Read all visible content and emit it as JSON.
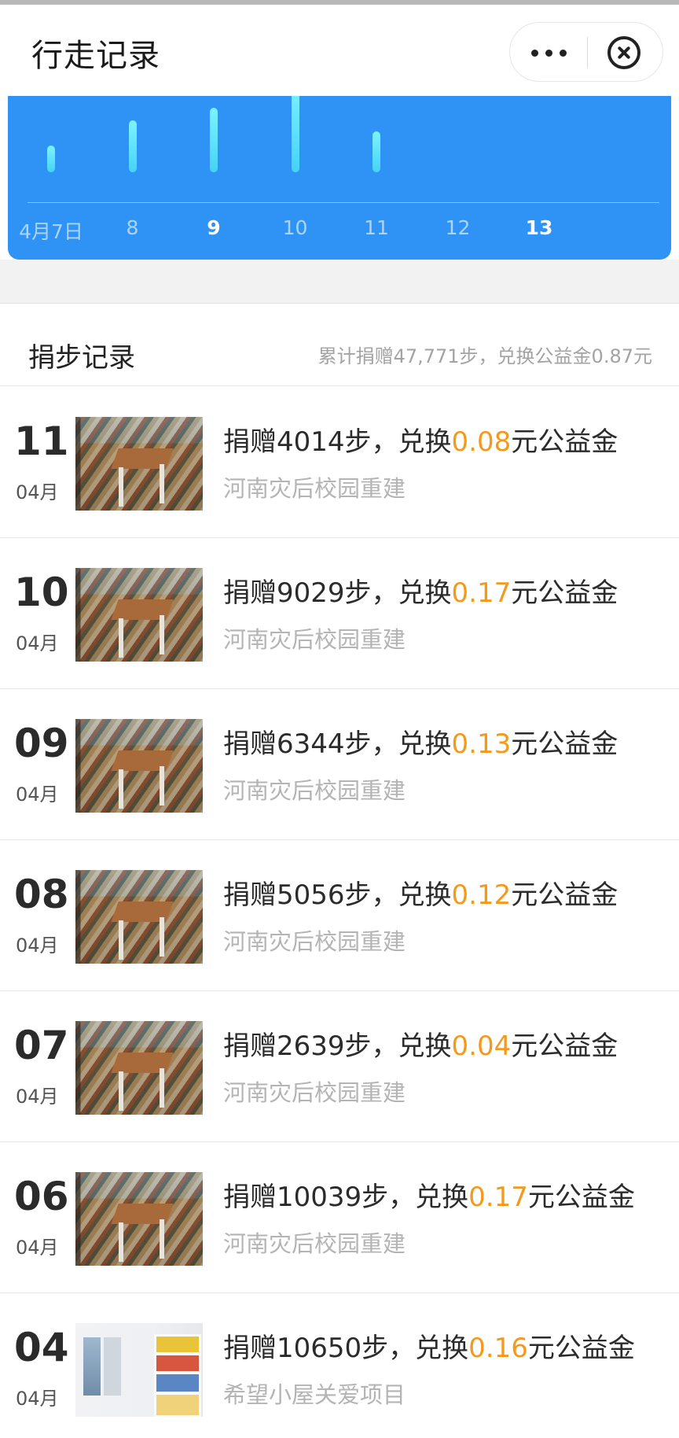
{
  "header": {
    "title": "行走记录"
  },
  "chart_data": {
    "type": "bar",
    "categories": [
      "4月7日",
      "8",
      "9",
      "10",
      "11",
      "12",
      "13"
    ],
    "values": [
      2639,
      5056,
      6344,
      9029,
      4014,
      0,
      0
    ],
    "highlighted_ticks": [
      "9",
      "13"
    ],
    "title": "",
    "xlabel": "",
    "ylabel": "",
    "colors": {
      "background": "#2f93f5",
      "bar": "#5fe2fb"
    }
  },
  "section": {
    "label": "捐步记录",
    "summary": "累计捐赠47,771步，兑换公益金0.87元"
  },
  "colors": {
    "accent_amount": "#f39a1e",
    "chart_bg": "#2f93f5"
  },
  "records": [
    {
      "day": "11",
      "month": "04月",
      "prefix": "捐赠4014步，兑换",
      "amount": "0.08",
      "suffix": "元公益金",
      "project": "河南灾后校园重建",
      "thumb": "rubble"
    },
    {
      "day": "10",
      "month": "04月",
      "prefix": "捐赠9029步，兑换",
      "amount": "0.17",
      "suffix": "元公益金",
      "project": "河南灾后校园重建",
      "thumb": "rubble"
    },
    {
      "day": "09",
      "month": "04月",
      "prefix": "捐赠6344步，兑换",
      "amount": "0.13",
      "suffix": "元公益金",
      "project": "河南灾后校园重建",
      "thumb": "rubble"
    },
    {
      "day": "08",
      "month": "04月",
      "prefix": "捐赠5056步，兑换",
      "amount": "0.12",
      "suffix": "元公益金",
      "project": "河南灾后校园重建",
      "thumb": "rubble"
    },
    {
      "day": "07",
      "month": "04月",
      "prefix": "捐赠2639步，兑换",
      "amount": "0.04",
      "suffix": "元公益金",
      "project": "河南灾后校园重建",
      "thumb": "rubble"
    },
    {
      "day": "06",
      "month": "04月",
      "prefix": "捐赠10039步，兑换",
      "amount": "0.17",
      "suffix": "元公益金",
      "project": "河南灾后校园重建",
      "thumb": "rubble"
    },
    {
      "day": "04",
      "month": "04月",
      "prefix": "捐赠10650步，兑换",
      "amount": "0.16",
      "suffix": "元公益金",
      "project": "希望小屋关爱项目",
      "thumb": "room"
    }
  ]
}
